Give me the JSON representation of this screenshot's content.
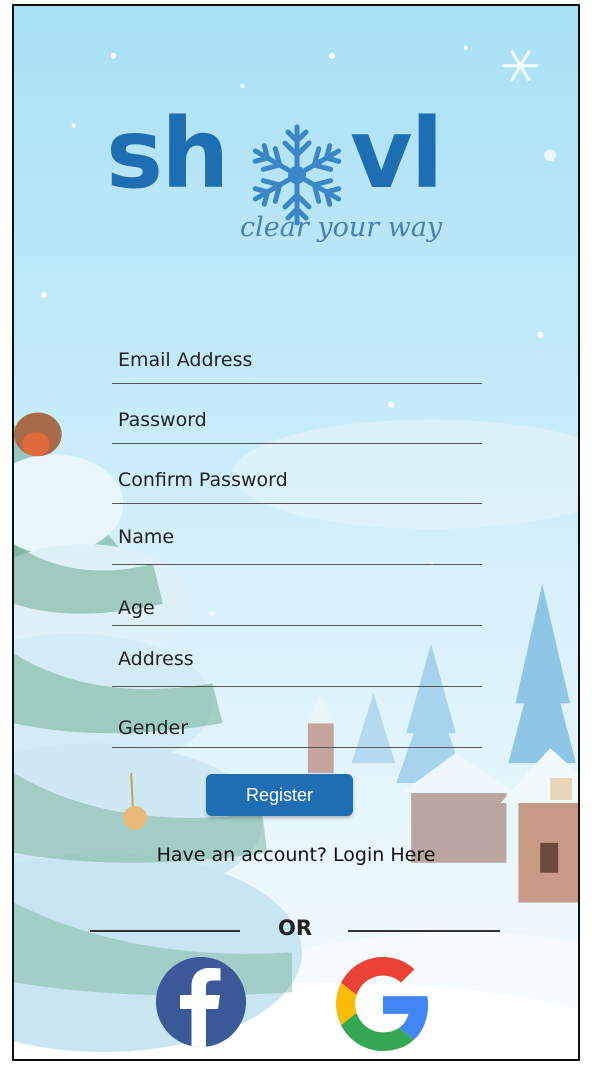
{
  "app": {
    "logo_left": "sh",
    "logo_right": "vl",
    "tagline": "clear your way",
    "brand_color": "#1f6db3"
  },
  "form": {
    "fields": [
      {
        "label": "Email Address"
      },
      {
        "label": "Password"
      },
      {
        "label": "Confirm Password"
      },
      {
        "label": "Name"
      },
      {
        "label": "Age"
      },
      {
        "label": "Address"
      },
      {
        "label": "Gender"
      }
    ],
    "register_label": "Register"
  },
  "login": {
    "text": "Have an account? Login Here"
  },
  "divider": {
    "text": "OR"
  },
  "social": {
    "facebook_icon": "facebook-icon",
    "google_icon": "google-icon"
  }
}
